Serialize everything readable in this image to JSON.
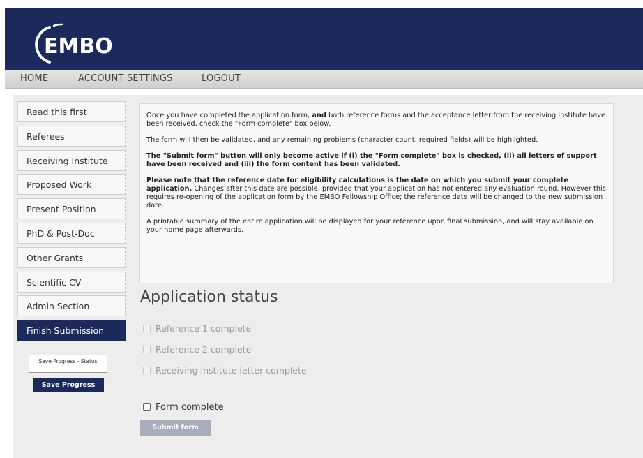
{
  "header": {
    "logo_text": "EMBO",
    "bg_color": "#1b2a5b"
  },
  "nav": [
    "HOME",
    "ACCOUNT SETTINGS",
    "LOGOUT"
  ],
  "sidebar": {
    "items": [
      {
        "label": "Read this first"
      },
      {
        "label": "Referees"
      },
      {
        "label": "Receiving Institute"
      },
      {
        "label": "Proposed Work"
      },
      {
        "label": "Present Position"
      },
      {
        "label": "PhD & Post-Doc"
      },
      {
        "label": "Other Grants"
      },
      {
        "label": "Scientific CV"
      },
      {
        "label": "Admin Section"
      },
      {
        "label": "Finish Submission",
        "active": true
      }
    ],
    "progress_status": "Save Progress - Status",
    "save_progress": "Save Progress"
  },
  "info": {
    "p1_a": "Once you have completed the application form, ",
    "p1_b": "and",
    "p1_c": " both reference forms and the acceptance letter from the receiving institute have been received, check the \"Form complete\" box below.",
    "p2": "The form will then be validated, and any remaining problems (character count, required fields) will be highlighted.",
    "p3": "The \"Submit form\" button will only become active if (i) the \"Form complete\" box is checked, (ii) all letters of support have been received and (iii) the form content has been validated.",
    "p4_a": "Please note that the reference date for eligibility calculations is the date on which you submit your complete application.",
    "p4_b": " Changes after this date are possible, provided that your application has not entered any evaluation round. However this requires re-opening of the application form by the EMBO Fellowship Office; the reference date will be changed to the new submission date.",
    "p5": "A printable summary of the entire application will be displayed for your reference upon final submission, and will stay available on your home page afterwards."
  },
  "status": {
    "title": "Application status",
    "items": [
      "Reference 1 complete",
      "Reference 2 complete",
      "Receiving Institute letter complete"
    ],
    "form_complete": "Form complete",
    "submit": "Submit form"
  }
}
